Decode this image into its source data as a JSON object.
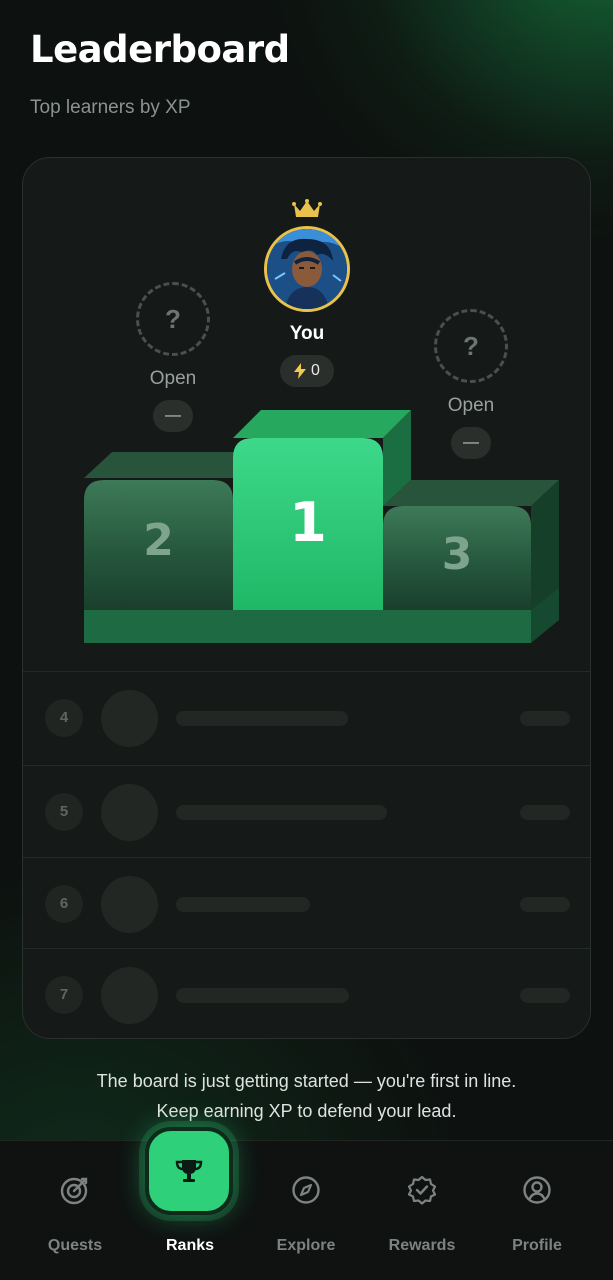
{
  "header": {
    "title": "Leaderboard",
    "subtitle": "Top learners by XP"
  },
  "podium": {
    "second": {
      "placeholder": "?",
      "name": "Open",
      "score": "—",
      "rank": "2"
    },
    "first": {
      "name": "You",
      "xp": "0",
      "rank": "1"
    },
    "third": {
      "placeholder": "?",
      "name": "Open",
      "score": "—",
      "rank": "3"
    }
  },
  "ranks": [
    {
      "rank": "4",
      "name_fill": 0.55,
      "score_fill": 1
    },
    {
      "rank": "5",
      "name_fill": 0.7,
      "score_fill": 1
    },
    {
      "rank": "6",
      "name_fill": 0.45,
      "score_fill": 1
    },
    {
      "rank": "7",
      "name_fill": 0.57,
      "score_fill": 1
    }
  ],
  "footer": {
    "line1": "The board is just getting started — you're first in line.",
    "line2": "Keep earning XP to defend your lead."
  },
  "nav": {
    "items": [
      {
        "label": "Quests",
        "icon": "target-icon"
      },
      {
        "label": "Ranks",
        "icon": "trophy-icon"
      },
      {
        "label": "Explore",
        "icon": "compass-icon"
      },
      {
        "label": "Rewards",
        "icon": "badge-check-icon"
      },
      {
        "label": "Profile",
        "icon": "user-circle-icon"
      }
    ],
    "active": "Ranks"
  },
  "colors": {
    "accent": "#2ed07a",
    "crown": "#e8c24a",
    "background": "#0d110f"
  }
}
